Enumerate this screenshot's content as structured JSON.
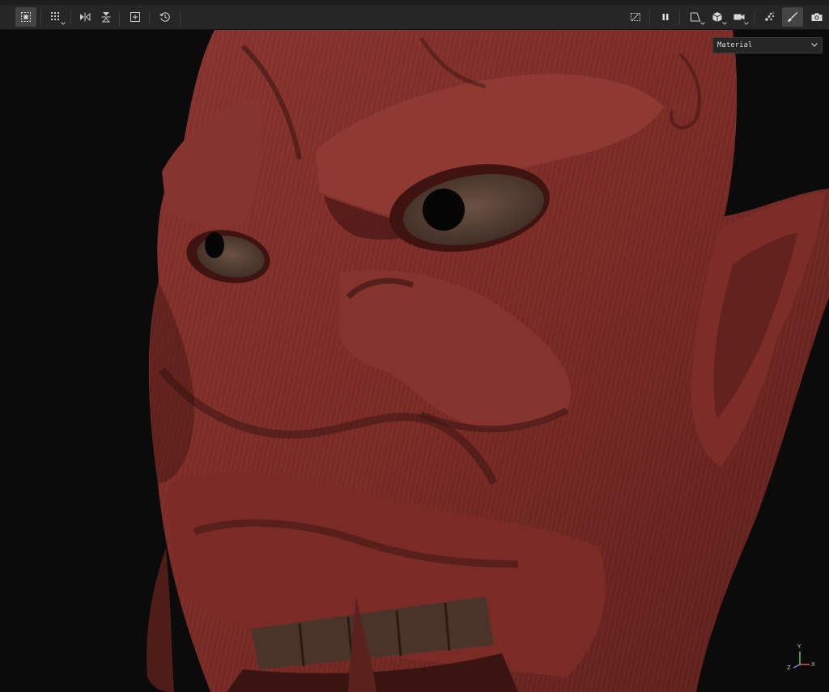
{
  "toolbar": {
    "left_tools": [
      {
        "name": "select-tool",
        "active": true
      },
      {
        "name": "grid-select-tool",
        "active": false
      },
      {
        "name": "mirror-x-tool",
        "active": false
      },
      {
        "name": "mirror-y-tool",
        "active": false
      },
      {
        "name": "frame-tool",
        "active": false
      },
      {
        "name": "history-tool",
        "active": false
      }
    ],
    "right_tools": [
      {
        "name": "hide-overlay-tool",
        "active": false
      },
      {
        "name": "pause-tool",
        "active": false
      },
      {
        "name": "camera-view-tool",
        "active": false
      },
      {
        "name": "object-cube-tool",
        "active": false
      },
      {
        "name": "video-camera-tool",
        "active": false
      },
      {
        "name": "particles-tool",
        "active": false
      },
      {
        "name": "paint-brush-tool",
        "active": true
      },
      {
        "name": "screenshot-tool",
        "active": false
      }
    ]
  },
  "viewport": {
    "display_mode": {
      "selected": "Material"
    },
    "gizmo": {
      "y_label": "Y",
      "x_label": "X",
      "z_label": "Z"
    }
  },
  "colors": {
    "toolbar_bg": "#262626",
    "viewport_bg": "#0b0b0b",
    "mask_red": "#7a2b26",
    "mask_dark": "#3c1512",
    "eye_brown": "#5a4336"
  }
}
